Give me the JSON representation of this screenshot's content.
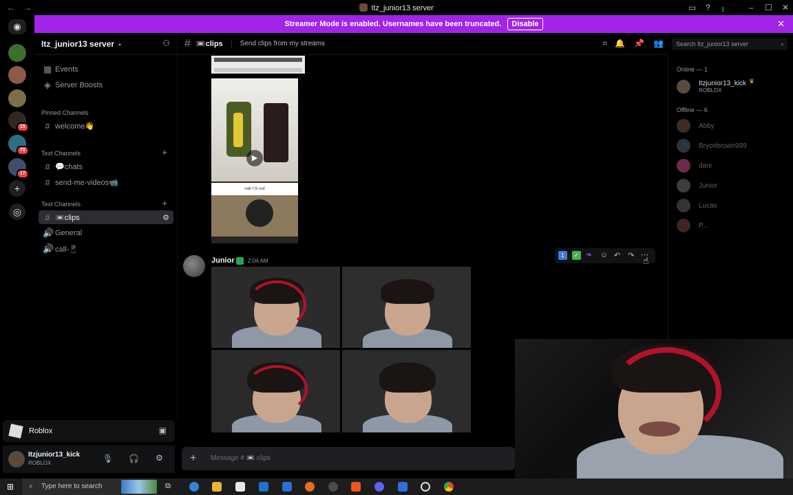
{
  "window": {
    "title": "Itz_junior13 server",
    "back": "←",
    "forward": "→"
  },
  "banner": {
    "text": "Streamer Mode is enabled. Usernames have been truncated.",
    "button": "Disable",
    "close": "✕"
  },
  "servers": {
    "badges": [
      "15",
      "70",
      "17"
    ],
    "add": "+",
    "discover": "◎"
  },
  "sidebar": {
    "server_name": "Itz_junior13 server",
    "top_items": [
      "Events",
      "Server Boosts"
    ],
    "pinned_label": "Pinned Channels",
    "pinned": [
      "welcome👋"
    ],
    "text_cat_1": "Text Channels",
    "text_1": [
      "💬chats",
      "send-me-videos📹"
    ],
    "text_cat_2": "Text Channels",
    "text_2": [
      "📼clips"
    ],
    "voice": [
      "General",
      "call-📱"
    ]
  },
  "activity": {
    "game": "Roblox"
  },
  "user": {
    "name": "Itzjunior13_kick",
    "status": "ROBLOX"
  },
  "channel": {
    "name": "📼clips",
    "topic": "Send clips from my streams"
  },
  "search": {
    "placeholder": "Search Itz_junior13 server"
  },
  "messages": {
    "attachment_caption": "nah I'm out",
    "author": "Junior",
    "timestamp": "2:04 AM"
  },
  "members": {
    "online_label": "Online — 1",
    "online": [
      {
        "name": "Itzjunior13_kick",
        "status": "ROBLOX"
      }
    ],
    "offline_label": "Offline — 6",
    "offline": [
      "Abby",
      "Brycebrown999",
      "dani",
      "Junior",
      "Lucas",
      "P..."
    ]
  },
  "composer": {
    "placeholder": "Message # 📼 clips"
  },
  "taskbar": {
    "search_placeholder": "Type here to search"
  },
  "colors": {
    "accent": "#a224e6",
    "bg": "#000000",
    "online": "#23a55a",
    "badge": "#f23f43"
  }
}
